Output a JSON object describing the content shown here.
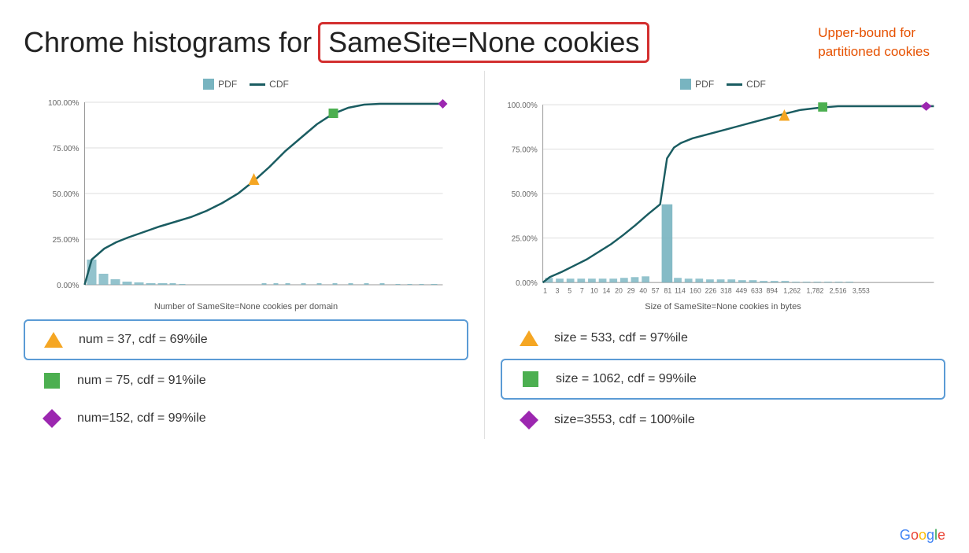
{
  "header": {
    "title_prefix": "Chrome histograms for",
    "title_highlight": "SameSite=None cookies",
    "annotation_line1": "Upper-bound for",
    "annotation_line2": "partitioned cookies"
  },
  "legend": {
    "pdf_label": "PDF",
    "cdf_label": "CDF"
  },
  "chart_left": {
    "label": "Number of SameSite=None cookies per domain",
    "y_ticks": [
      "100.00%",
      "75.00%",
      "50.00%",
      "25.00%",
      "0.00%"
    ],
    "stats": [
      {
        "shape": "triangle",
        "color": "#f5a623",
        "text": "num = 37, cdf = 69%ile",
        "highlighted": true
      },
      {
        "shape": "square",
        "color": "#4caf50",
        "text": "num = 75, cdf = 91%ile",
        "highlighted": false
      },
      {
        "shape": "diamond",
        "color": "#9c27b0",
        "text": "num=152, cdf = 99%ile",
        "highlighted": false
      }
    ]
  },
  "chart_right": {
    "label": "Size of SameSite=None cookies in bytes",
    "x_ticks": [
      "1",
      "3",
      "5",
      "7",
      "10",
      "14",
      "20",
      "29",
      "40",
      "57",
      "81",
      "114",
      "160",
      "226",
      "318",
      "449",
      "633",
      "894",
      "1,262",
      "1,782",
      "2,516",
      "3,553"
    ],
    "y_ticks": [
      "100.00%",
      "75.00%",
      "50.00%",
      "25.00%",
      "0.00%"
    ],
    "stats": [
      {
        "shape": "triangle",
        "color": "#f5a623",
        "text": "size = 533, cdf = 97%ile",
        "highlighted": false
      },
      {
        "shape": "square",
        "color": "#4caf50",
        "text": "size = 1062, cdf = 99%ile",
        "highlighted": true
      },
      {
        "shape": "diamond",
        "color": "#9c27b0",
        "text": "size=3553, cdf = 100%ile",
        "highlighted": false
      }
    ]
  },
  "google": "Google"
}
